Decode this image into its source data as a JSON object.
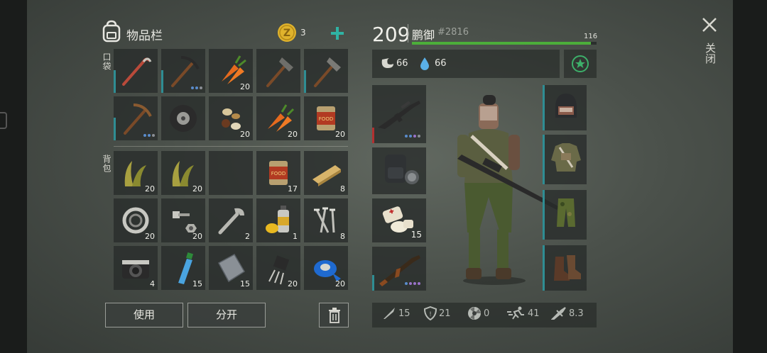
{
  "inventory": {
    "title": "物品栏",
    "coins": "3",
    "pocket_label": "口袋",
    "backpack_label": "背包",
    "pockets": [
      {
        "icon": "crowbar-icon",
        "count": ""
      },
      {
        "icon": "pickaxe-icon",
        "count": ""
      },
      {
        "icon": "carrot-icon",
        "count": "20"
      },
      {
        "icon": "hammer-icon",
        "count": ""
      },
      {
        "icon": "hammer-icon",
        "count": ""
      },
      {
        "icon": "pickaxe-icon",
        "count": ""
      },
      {
        "icon": "tire-icon",
        "count": ""
      },
      {
        "icon": "seeds-icon",
        "count": "20"
      },
      {
        "icon": "carrot-icon",
        "count": "20"
      },
      {
        "icon": "canned-food-icon",
        "count": "20"
      }
    ],
    "backpack": [
      {
        "icon": "grass-icon",
        "count": "20"
      },
      {
        "icon": "grass-icon",
        "count": "20"
      },
      {
        "icon": "empty",
        "count": ""
      },
      {
        "icon": "canned-food-icon",
        "count": "17"
      },
      {
        "icon": "wood-plank-icon",
        "count": "8"
      },
      {
        "icon": "bearing-icon",
        "count": "20"
      },
      {
        "icon": "bolt-nut-icon",
        "count": "20"
      },
      {
        "icon": "wrench-icon",
        "count": "2"
      },
      {
        "icon": "spray-can-icon",
        "count": "1"
      },
      {
        "icon": "nails-icon",
        "count": "8"
      },
      {
        "icon": "camera-icon",
        "count": "4"
      },
      {
        "icon": "water-bottle-icon",
        "count": "15"
      },
      {
        "icon": "metal-plate-icon",
        "count": "15"
      },
      {
        "icon": "transistor-icon",
        "count": "20"
      },
      {
        "icon": "tape-icon",
        "count": "20"
      }
    ],
    "use_button": "使用",
    "split_button": "分开"
  },
  "character": {
    "level": "209",
    "name": "鹏御",
    "id_tag": "#2816",
    "xp_value": "116",
    "xp_progress": 0.97,
    "food": "66",
    "water": "66",
    "medkit_count": "15",
    "stats": {
      "attack": "15",
      "defense": "21",
      "radiation": "0",
      "speed": "41",
      "weapon": "8.3"
    }
  },
  "close_label": "关闭",
  "colors": {
    "accent_teal": "#2f8d93",
    "xp_green": "#4cae3a",
    "coin_gold": "#e0b32c",
    "plus_teal": "#2fb3a4"
  }
}
